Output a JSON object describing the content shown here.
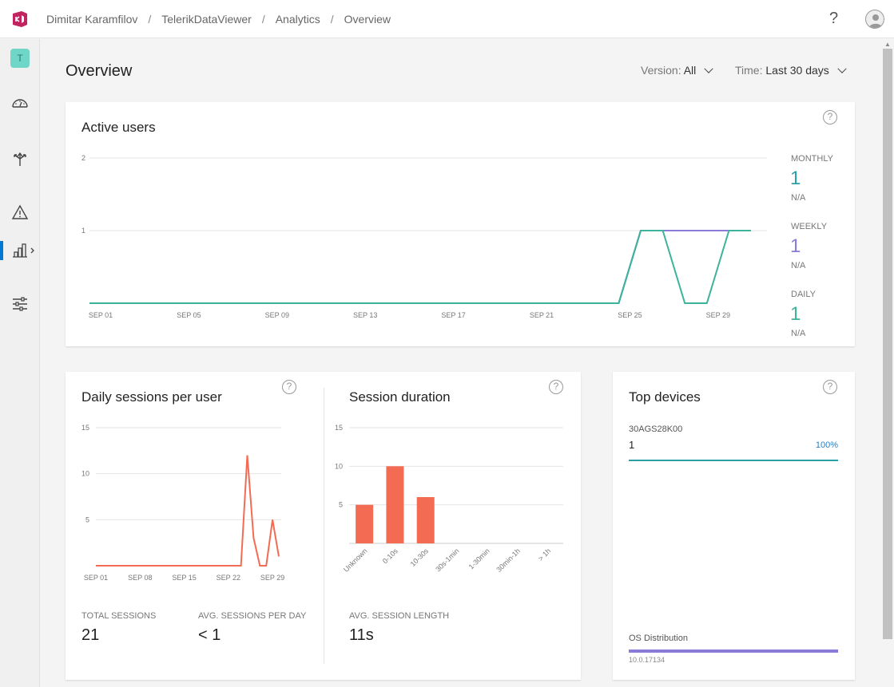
{
  "breadcrumb": [
    "Dimitar Karamfilov",
    "TelerikDataViewer",
    "Analytics",
    "Overview"
  ],
  "sidebar": {
    "team_initial": "T"
  },
  "page": {
    "title": "Overview"
  },
  "filters": {
    "version_label": "Version:",
    "version_value": "All",
    "time_label": "Time:",
    "time_value": "Last 30 days"
  },
  "active_users": {
    "title": "Active users",
    "help": "?",
    "monthly": {
      "label": "MONTHLY",
      "value": "1",
      "change": "N/A",
      "color": "#2a9fa8"
    },
    "weekly": {
      "label": "WEEKLY",
      "value": "1",
      "change": "N/A",
      "color": "#8c7bd6"
    },
    "daily": {
      "label": "DAILY",
      "value": "1",
      "change": "N/A",
      "color": "#3cb39a"
    }
  },
  "daily_sessions": {
    "title": "Daily sessions per user",
    "help": "?",
    "total_label": "TOTAL SESSIONS",
    "total_value": "21",
    "avg_label": "AVG. SESSIONS PER DAY",
    "avg_value": "< 1"
  },
  "session_duration": {
    "title": "Session duration",
    "help": "?",
    "avg_label": "AVG. SESSION LENGTH",
    "avg_value": "11s"
  },
  "top_devices": {
    "title": "Top devices",
    "help": "?",
    "device_name": "30AGS28K00",
    "device_count": "1",
    "device_percent": "100%",
    "os_label": "OS Distribution",
    "os_version": "10.0.17134",
    "accent": "#2a9fa8",
    "os_color": "#8c7bd6"
  },
  "chart_data": [
    {
      "type": "line",
      "title": "Active users",
      "xlabel": "",
      "ylabel": "",
      "x_ticks": [
        "SEP 01",
        "SEP 05",
        "SEP 09",
        "SEP 13",
        "SEP 17",
        "SEP 21",
        "SEP 25",
        "SEP 29"
      ],
      "y_ticks": [
        1,
        2
      ],
      "ylim": [
        0,
        2
      ],
      "x": [
        "Sep 01",
        "Sep 02",
        "Sep 03",
        "Sep 04",
        "Sep 05",
        "Sep 06",
        "Sep 07",
        "Sep 08",
        "Sep 09",
        "Sep 10",
        "Sep 11",
        "Sep 12",
        "Sep 13",
        "Sep 14",
        "Sep 15",
        "Sep 16",
        "Sep 17",
        "Sep 18",
        "Sep 19",
        "Sep 20",
        "Sep 21",
        "Sep 22",
        "Sep 23",
        "Sep 24",
        "Sep 25",
        "Sep 26",
        "Sep 27",
        "Sep 28",
        "Sep 29",
        "Sep 30",
        "Oct 01"
      ],
      "series": [
        {
          "name": "MONTHLY",
          "color": "#2a9fa8",
          "values": [
            0,
            0,
            0,
            0,
            0,
            0,
            0,
            0,
            0,
            0,
            0,
            0,
            0,
            0,
            0,
            0,
            0,
            0,
            0,
            0,
            0,
            0,
            0,
            0,
            0,
            1,
            1,
            1,
            1,
            1,
            1
          ]
        },
        {
          "name": "WEEKLY",
          "color": "#8c7bd6",
          "values": [
            0,
            0,
            0,
            0,
            0,
            0,
            0,
            0,
            0,
            0,
            0,
            0,
            0,
            0,
            0,
            0,
            0,
            0,
            0,
            0,
            0,
            0,
            0,
            0,
            0,
            1,
            1,
            1,
            1,
            1,
            1
          ]
        },
        {
          "name": "DAILY",
          "color": "#3cb39a",
          "values": [
            0,
            0,
            0,
            0,
            0,
            0,
            0,
            0,
            0,
            0,
            0,
            0,
            0,
            0,
            0,
            0,
            0,
            0,
            0,
            0,
            0,
            0,
            0,
            0,
            0,
            1,
            1,
            0,
            0,
            1,
            1
          ]
        }
      ],
      "grid": true
    },
    {
      "type": "line",
      "title": "Daily sessions per user",
      "xlabel": "",
      "ylabel": "",
      "x_ticks": [
        "SEP 01",
        "SEP 08",
        "SEP 15",
        "SEP 22",
        "SEP 29"
      ],
      "y_ticks": [
        5,
        10,
        15
      ],
      "ylim": [
        0,
        15
      ],
      "x": [
        "Sep 01",
        "Sep 02",
        "Sep 03",
        "Sep 04",
        "Sep 05",
        "Sep 06",
        "Sep 07",
        "Sep 08",
        "Sep 09",
        "Sep 10",
        "Sep 11",
        "Sep 12",
        "Sep 13",
        "Sep 14",
        "Sep 15",
        "Sep 16",
        "Sep 17",
        "Sep 18",
        "Sep 19",
        "Sep 20",
        "Sep 21",
        "Sep 22",
        "Sep 23",
        "Sep 24",
        "Sep 25",
        "Sep 26",
        "Sep 27",
        "Sep 28",
        "Sep 29",
        "Sep 30"
      ],
      "series": [
        {
          "color": "#f26b52",
          "values": [
            0,
            0,
            0,
            0,
            0,
            0,
            0,
            0,
            0,
            0,
            0,
            0,
            0,
            0,
            0,
            0,
            0,
            0,
            0,
            0,
            0,
            0,
            0,
            0,
            12,
            3,
            0,
            0,
            5,
            1
          ]
        }
      ],
      "grid": true
    },
    {
      "type": "bar",
      "title": "Session duration",
      "categories": [
        "Unknown",
        "0-10s",
        "10-30s",
        "30s-1min",
        "1-30min",
        "30min-1h",
        "> 1h"
      ],
      "values": [
        5,
        10,
        6,
        0,
        0,
        0,
        0
      ],
      "y_ticks": [
        5,
        10,
        15
      ],
      "ylim": [
        0,
        15
      ],
      "color": "#f26b52",
      "grid": true
    }
  ]
}
